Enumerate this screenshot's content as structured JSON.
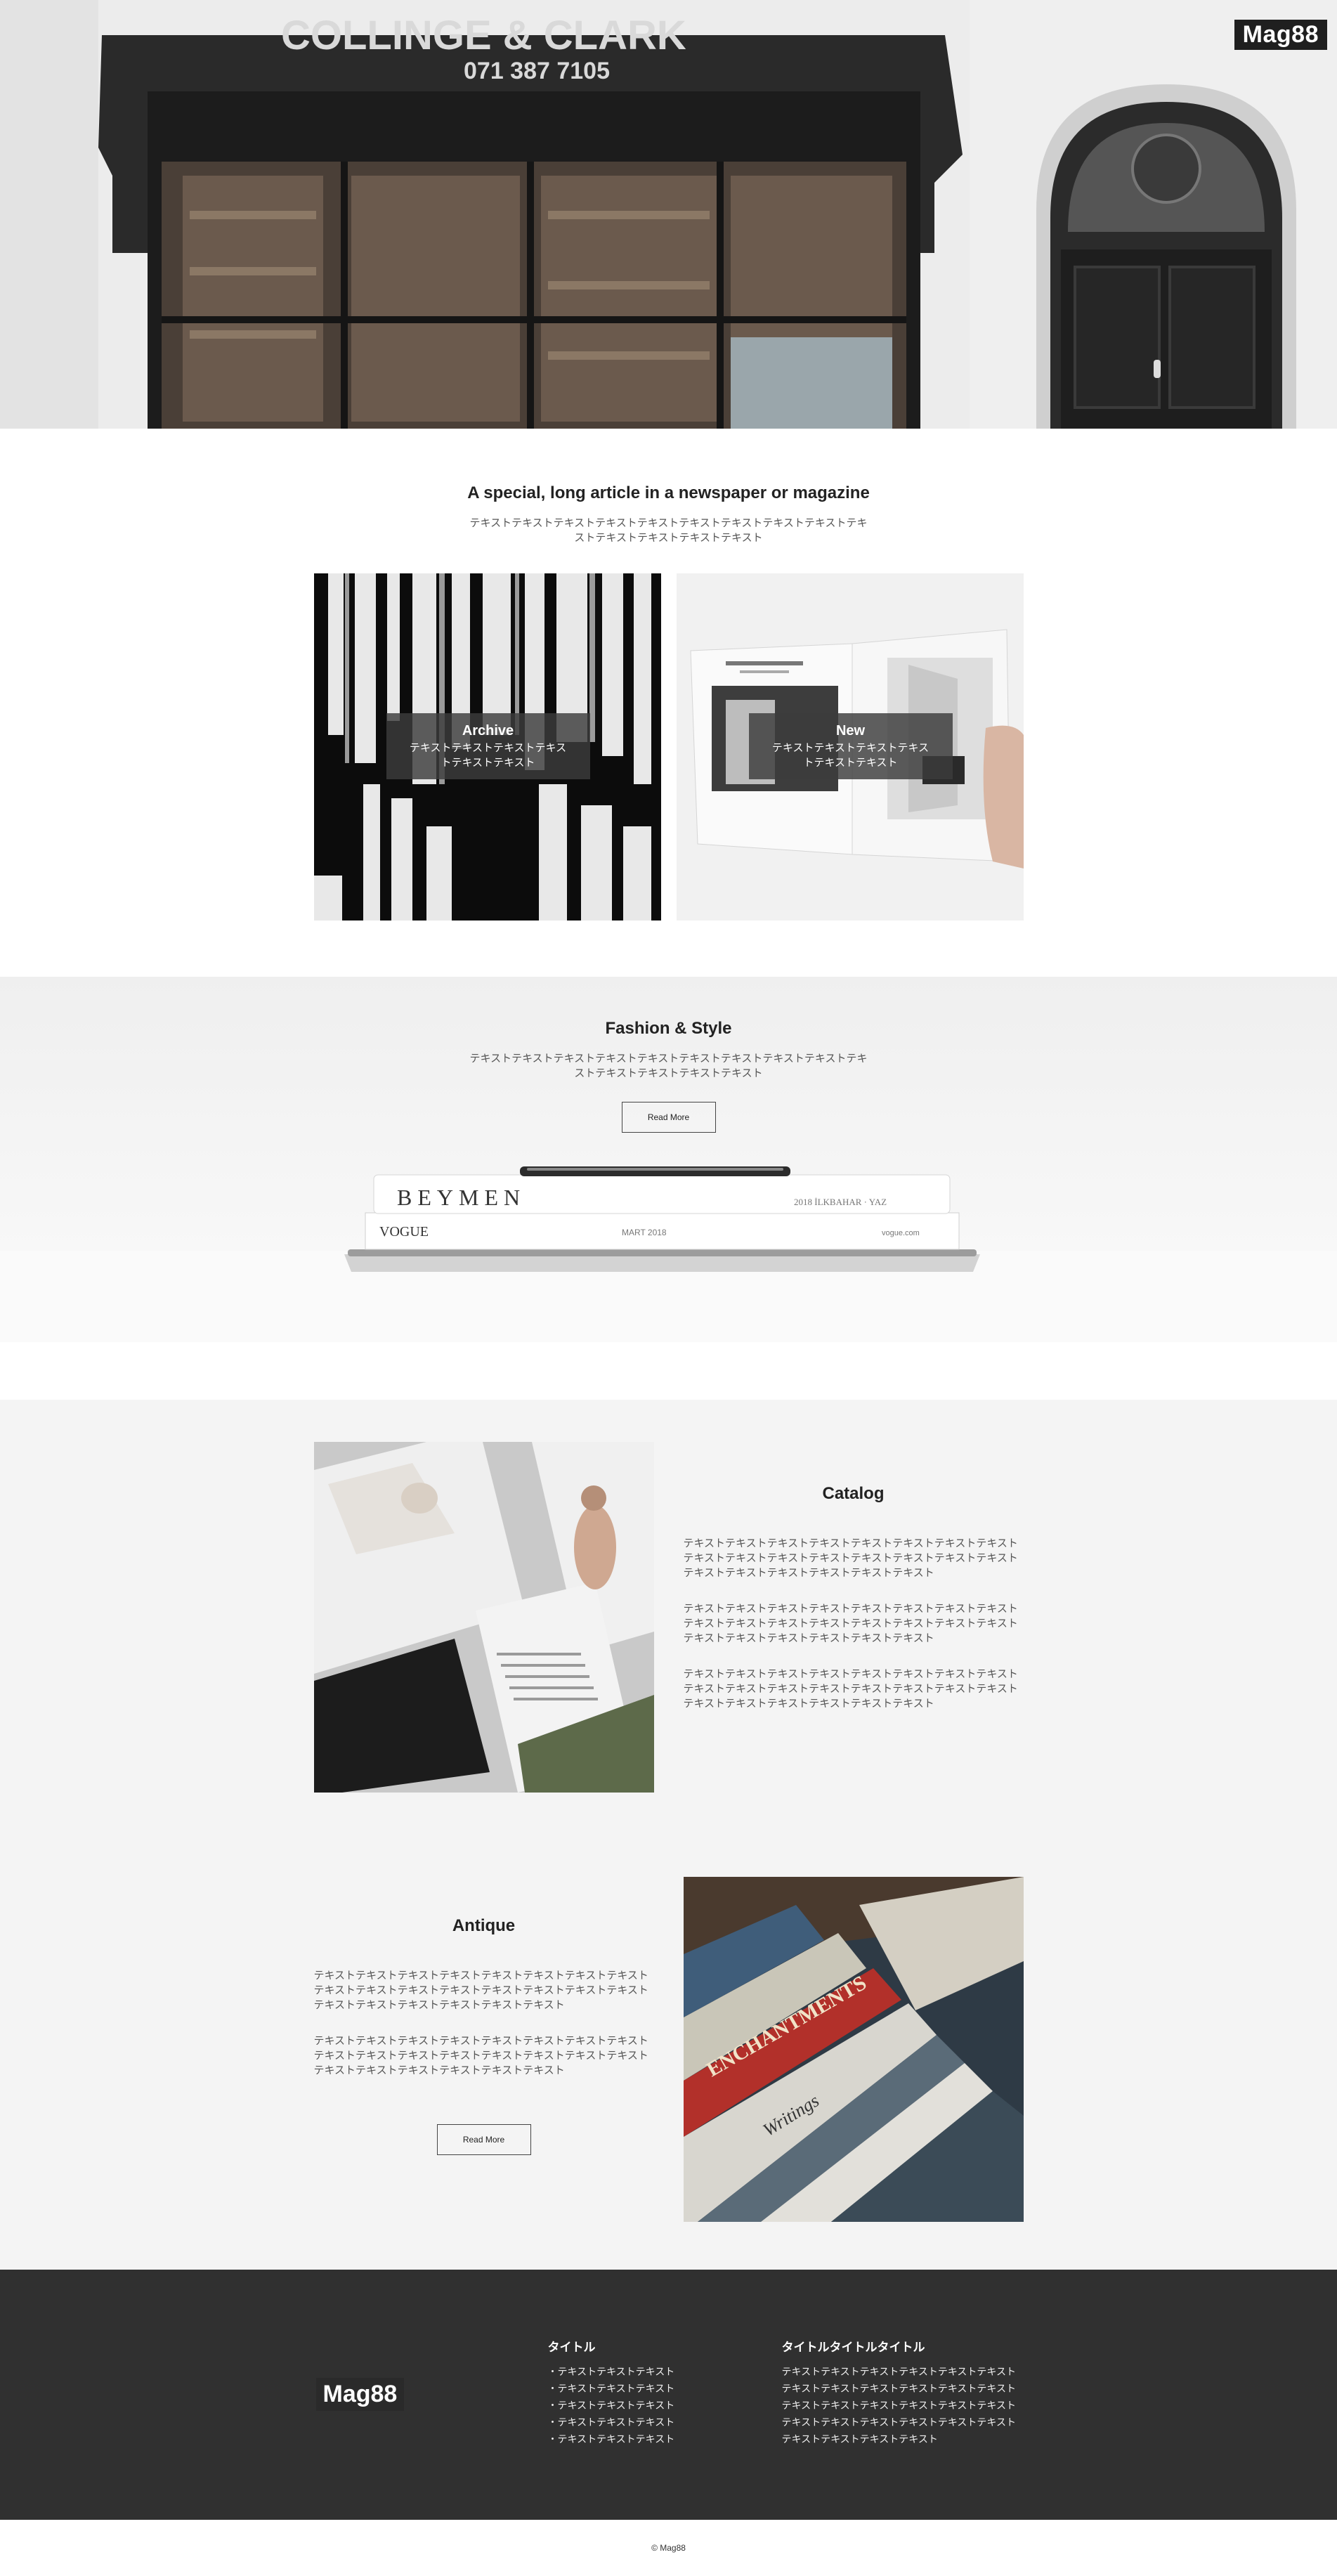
{
  "site": {
    "logo": "Mag88"
  },
  "hero": {
    "sign_text": "COLLINGE & CLARK",
    "sign_phone": "071 387 7105"
  },
  "intro": {
    "title": "A special, long article in a newspaper or magazine",
    "text": "テキストテキストテキストテキストテキストテキストテキストテキストテキストテキストテキストテキストテキストテキスト"
  },
  "cards": [
    {
      "title": "Archive",
      "text": "テキストテキストテキストテキストテキストテキスト"
    },
    {
      "title": "New",
      "text": "テキストテキストテキストテキストテキストテキスト"
    }
  ],
  "fashion": {
    "title": "Fashion & Style",
    "text": "テキストテキストテキストテキストテキストテキストテキストテキストテキストテキストテキストテキストテキストテキスト",
    "button": "Read More",
    "magazine_brand": "BEYMEN",
    "magazine_issue": "2018 İLKBAHAR · YAZ",
    "vogue": "VOGUE",
    "vogue_date": "MART 2018",
    "vogue_site": "vogue.com"
  },
  "catalog": {
    "title": "Catalog",
    "paragraphs": [
      "テキストテキストテキストテキストテキストテキストテキストテキストテキストテキストテキストテキストテキストテキストテキストテキストテキストテキストテキストテキストテキストテキスト",
      "テキストテキストテキストテキストテキストテキストテキストテキストテキストテキストテキストテキストテキストテキストテキストテキストテキストテキストテキストテキストテキストテキスト",
      "テキストテキストテキストテキストテキストテキストテキストテキストテキストテキストテキストテキストテキストテキストテキストテキストテキストテキストテキストテキストテキストテキスト"
    ]
  },
  "antique": {
    "title": "Antique",
    "paragraphs": [
      "テキストテキストテキストテキストテキストテキストテキストテキストテキストテキストテキストテキストテキストテキストテキストテキストテキストテキストテキストテキストテキストテキスト",
      "テキストテキストテキストテキストテキストテキストテキストテキストテキストテキストテキストテキストテキストテキストテキストテキストテキストテキストテキストテキストテキストテキスト"
    ],
    "button": "Read More"
  },
  "footer": {
    "logo": "Mag88",
    "col1_title": "タイトル",
    "col1_items": [
      "・テキストテキストテキスト",
      "・テキストテキストテキスト",
      "・テキストテキストテキスト",
      "・テキストテキストテキスト",
      "・テキストテキストテキスト"
    ],
    "col2_title": "タイトルタイトルタイトル",
    "col2_text": "テキストテキストテキストテキストテキストテキストテキストテキストテキストテキストテキストテキストテキストテキストテキストテキストテキストテキストテキストテキストテキストテキストテキストテキストテキストテキストテキストテキスト",
    "copyright": "© Mag88"
  },
  "colors": {
    "footer_bg": "#303030",
    "section_gray": "#f4f4f4",
    "overlay": "#3c3c3c"
  }
}
